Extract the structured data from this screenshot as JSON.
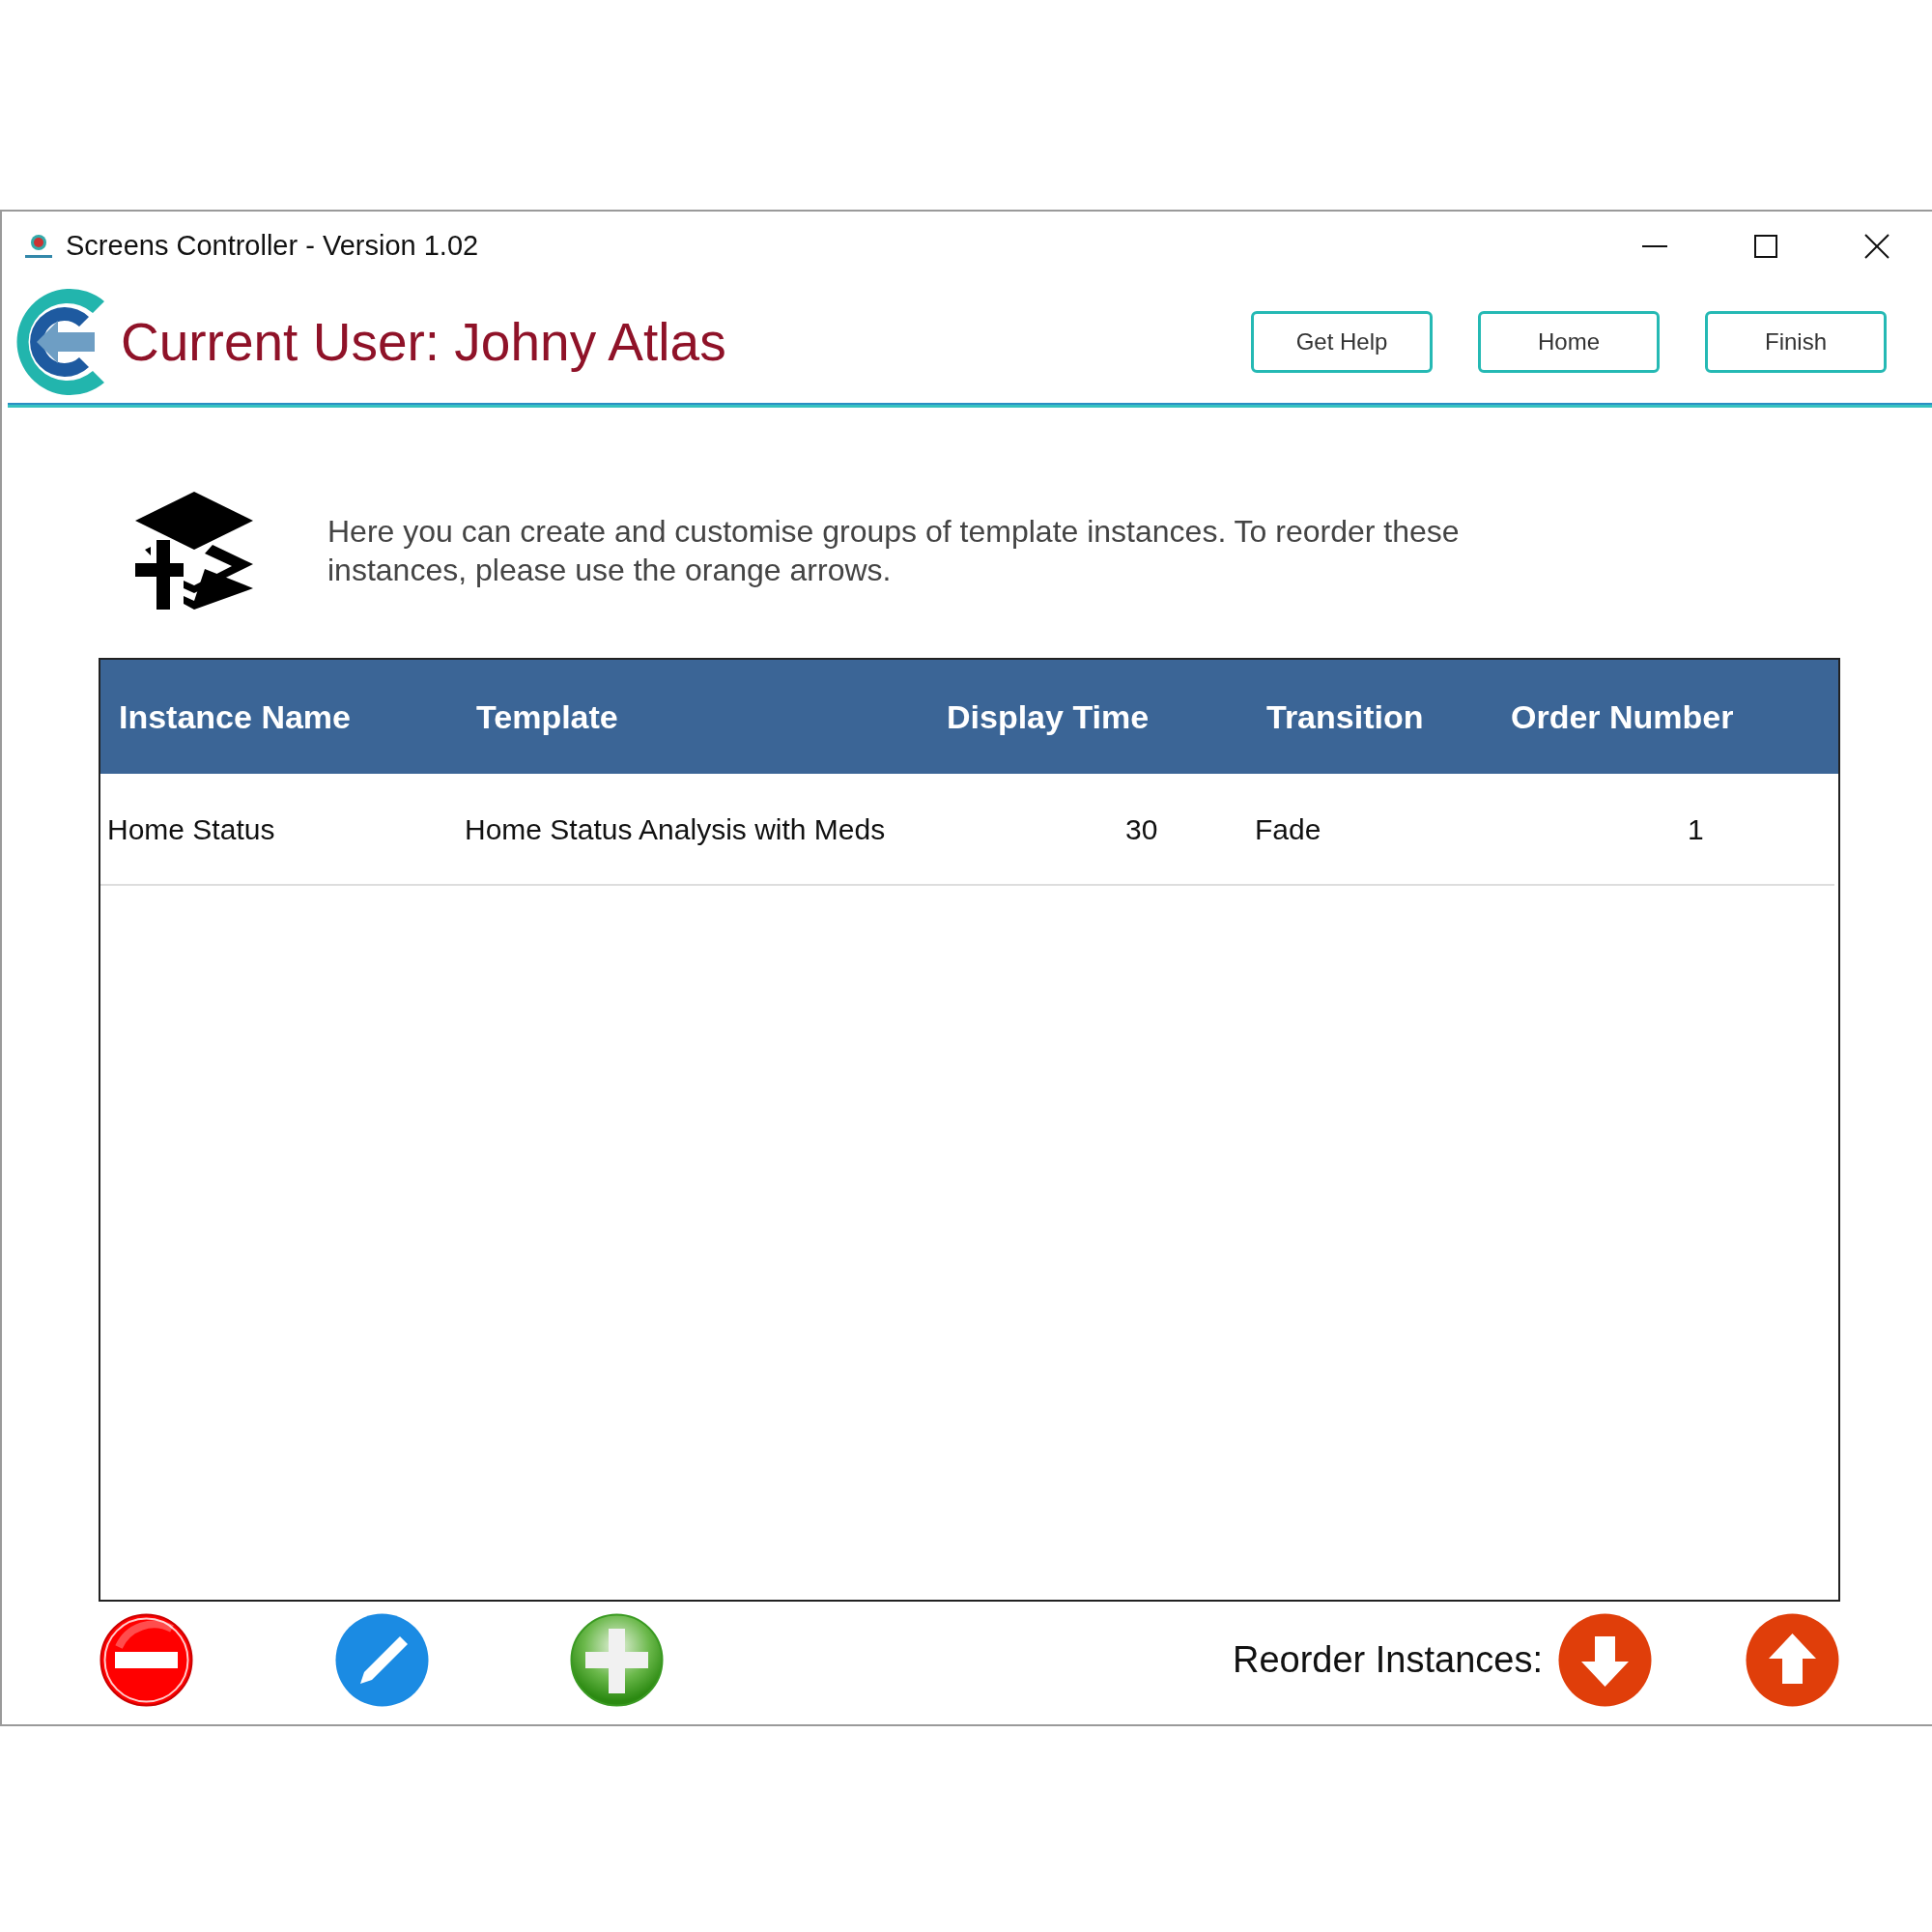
{
  "window": {
    "title": "Screens Controller - Version 1.02"
  },
  "header": {
    "title": "Current User: Johny Atlas",
    "buttons": [
      "Get Help",
      "Home",
      "Finish"
    ]
  },
  "intro": {
    "text": "Here you can create and customise groups of template instances. To reorder these instances, please use the orange arrows."
  },
  "table": {
    "columns": [
      "Instance Name",
      "Template",
      "Display Time",
      "Transition",
      "Order Number"
    ],
    "rows": [
      [
        "Home Status",
        "Home Status Analysis with Meds",
        "30",
        "Fade",
        "1"
      ]
    ]
  },
  "footer": {
    "reorder_label": "Reorder Instances:"
  }
}
